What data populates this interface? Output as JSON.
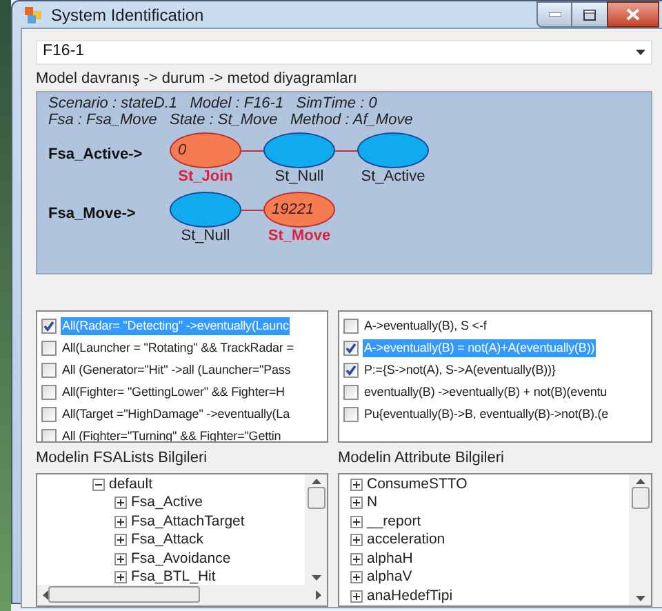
{
  "window": {
    "title": "System Identification"
  },
  "model_select": {
    "value": "F16-1"
  },
  "diagram_section": {
    "label": "Model davranış -> durum -> metod diyagramları",
    "info_lines": [
      "Scenario : stateD.1   Model : F16-1   SimTime : 0",
      "Fsa : Fsa_Move   State : St_Move   Method : Af_Move"
    ],
    "rows": [
      {
        "label": "Fsa_Active->",
        "nodes": [
          {
            "value": "0",
            "label": "St_Join",
            "active": true
          },
          {
            "label": "St_Null",
            "active": false
          },
          {
            "label": "St_Active",
            "active": false
          }
        ]
      },
      {
        "label": "Fsa_Move->",
        "nodes": [
          {
            "label": "St_Null",
            "active": false
          },
          {
            "value": "19221",
            "label": "St_Move",
            "active": true
          }
        ]
      }
    ]
  },
  "rule_list": {
    "items": [
      {
        "text": "All(Radar= \"Detecting\" ->eventually(Launc",
        "checked": true,
        "selected": true
      },
      {
        "text": "All(Launcher = \"Rotating\" && TrackRadar =",
        "checked": false,
        "selected": false
      },
      {
        "text": "All (Generator=\"Hit\" ->all (Launcher=\"Pass",
        "checked": false,
        "selected": false
      },
      {
        "text": "All(Fighter= \"GettingLower\" && Fighter=H",
        "checked": false,
        "selected": false
      },
      {
        "text": "All(Target =\"HighDamage\" ->eventually(La",
        "checked": false,
        "selected": false
      },
      {
        "text": "All (Fighter=\"Turning\" &&  Fighter=\"Gettin",
        "checked": false,
        "selected": false
      }
    ]
  },
  "pattern_list": {
    "items": [
      {
        "text": "A->eventually(B), S <-f",
        "checked": false,
        "selected": false
      },
      {
        "text": "A->eventually(B) = not(A)+A(eventually(B))",
        "checked": true,
        "selected": true
      },
      {
        "text": "P:={S->not(A), S->A(eventually(B))}",
        "checked": true,
        "selected": false
      },
      {
        "text": "eventually(B) ->eventually(B) + not(B)(eventu",
        "checked": false,
        "selected": false
      },
      {
        "text": "Pu{eventually(B)->B, eventually(B)->not(B).(e",
        "checked": false,
        "selected": false
      }
    ]
  },
  "fsa_tree": {
    "label": "Modelin FSALists Bilgileri",
    "items": [
      {
        "text": "default",
        "expanded": true,
        "children": [
          {
            "text": "Fsa_Active",
            "expanded": false
          },
          {
            "text": "Fsa_AttachTarget",
            "expanded": false
          },
          {
            "text": "Fsa_Attack",
            "expanded": false
          },
          {
            "text": "Fsa_Avoidance",
            "expanded": false
          },
          {
            "text": "Fsa_BTL_Hit",
            "expanded": false
          }
        ]
      }
    ]
  },
  "attribute_tree": {
    "label": "Modelin Attribute Bilgileri",
    "items": [
      {
        "text": "ConsumeSTTO",
        "expanded": false
      },
      {
        "text": "N",
        "expanded": false
      },
      {
        "text": "__report",
        "expanded": false
      },
      {
        "text": "acceleration",
        "expanded": false
      },
      {
        "text": "alphaH",
        "expanded": false
      },
      {
        "text": "alphaV",
        "expanded": false
      },
      {
        "text": "anaHedefTipi",
        "expanded": false
      }
    ]
  }
}
